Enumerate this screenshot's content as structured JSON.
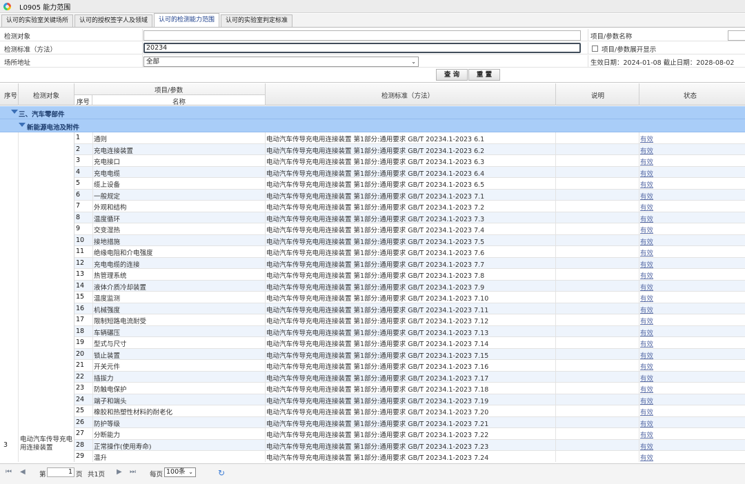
{
  "window": {
    "title": "L0905 能力范围"
  },
  "tabs": [
    {
      "label": "认可的实验室关键场所"
    },
    {
      "label": "认可的授权签字人及领域"
    },
    {
      "label": "认可的检测能力范围"
    },
    {
      "label": "认可的实验室判定标准"
    }
  ],
  "filters": {
    "object_label": "检测对象",
    "object_value": "",
    "standard_label": "检测标准（方法）",
    "standard_value": "20234",
    "site_label": "场所地址",
    "site_value": "全部",
    "param_label": "项目/参数名称",
    "param_value": "",
    "expand_label": "项目/参数展开显示",
    "date_text": "生效日期：2024-01-08 截止日期：2028-08-02",
    "query_button": "查 询",
    "reset_button": "重 置"
  },
  "grid": {
    "headers": {
      "seq": "序号",
      "object": "检测对象",
      "item_param": "项目/参数",
      "sub_seq": "序号",
      "sub_name": "名称",
      "standard": "检测标准（方法）",
      "note": "说明",
      "status": "状态"
    },
    "group1": "三、汽车零部件",
    "group2": "新能源电池及附件",
    "row_seq": "3",
    "row_object": "电动汽车传导充电用连接装置",
    "status_text": "有效",
    "rows": [
      {
        "n": "1",
        "name": "通则",
        "std": "电动汽车传导充电用连接装置 第1部分:通用要求 GB/T 20234.1-2023 6.1"
      },
      {
        "n": "2",
        "name": "充电连接装置",
        "std": "电动汽车传导充电用连接装置 第1部分:通用要求 GB/T 20234.1-2023 6.2"
      },
      {
        "n": "3",
        "name": "充电接口",
        "std": "电动汽车传导充电用连接装置 第1部分:通用要求 GB/T 20234.1-2023 6.3"
      },
      {
        "n": "4",
        "name": "充电电缆",
        "std": "电动汽车传导充电用连接装置 第1部分:通用要求 GB/T 20234.1-2023 6.4"
      },
      {
        "n": "5",
        "name": "缆上设备",
        "std": "电动汽车传导充电用连接装置 第1部分:通用要求 GB/T 20234.1-2023 6.5"
      },
      {
        "n": "6",
        "name": "一般规定",
        "std": "电动汽车传导充电用连接装置 第1部分:通用要求 GB/T 20234.1-2023 7.1"
      },
      {
        "n": "7",
        "name": "外观和结构",
        "std": "电动汽车传导充电用连接装置 第1部分:通用要求 GB/T 20234.1-2023 7.2"
      },
      {
        "n": "8",
        "name": "温度循环",
        "std": "电动汽车传导充电用连接装置 第1部分:通用要求 GB/T 20234.1-2023 7.3"
      },
      {
        "n": "9",
        "name": "交变湿热",
        "std": "电动汽车传导充电用连接装置 第1部分:通用要求 GB/T 20234.1-2023 7.4"
      },
      {
        "n": "10",
        "name": "接地措施",
        "std": "电动汽车传导充电用连接装置 第1部分:通用要求 GB/T 20234.1-2023 7.5"
      },
      {
        "n": "11",
        "name": "绝缘电阻和介电强度",
        "std": "电动汽车传导充电用连接装置 第1部分:通用要求 GB/T 20234.1-2023 7.6"
      },
      {
        "n": "12",
        "name": "充电电缆的连接",
        "std": "电动汽车传导充电用连接装置 第1部分:通用要求 GB/T 20234.1-2023 7.7"
      },
      {
        "n": "13",
        "name": "热管理系统",
        "std": "电动汽车传导充电用连接装置 第1部分:通用要求 GB/T 20234.1-2023 7.8"
      },
      {
        "n": "14",
        "name": "液体介质冷却装置",
        "std": "电动汽车传导充电用连接装置 第1部分:通用要求 GB/T 20234.1-2023 7.9"
      },
      {
        "n": "15",
        "name": "温度监测",
        "std": "电动汽车传导充电用连接装置 第1部分:通用要求 GB/T 20234.1-2023 7.10"
      },
      {
        "n": "16",
        "name": "机械强度",
        "std": "电动汽车传导充电用连接装置 第1部分:通用要求 GB/T 20234.1-2023 7.11"
      },
      {
        "n": "17",
        "name": "限制短路电流耐受",
        "std": "电动汽车传导充电用连接装置 第1部分:通用要求 GB/T 20234.1-2023 7.12"
      },
      {
        "n": "18",
        "name": "车辆碾压",
        "std": "电动汽车传导充电用连接装置 第1部分:通用要求 GB/T 20234.1-2023 7.13"
      },
      {
        "n": "19",
        "name": "型式与尺寸",
        "std": "电动汽车传导充电用连接装置 第1部分:通用要求 GB/T 20234.1-2023 7.14"
      },
      {
        "n": "20",
        "name": "锁止装置",
        "std": "电动汽车传导充电用连接装置 第1部分:通用要求 GB/T 20234.1-2023 7.15"
      },
      {
        "n": "21",
        "name": "开关元件",
        "std": "电动汽车传导充电用连接装置 第1部分:通用要求 GB/T 20234.1-2023 7.16"
      },
      {
        "n": "22",
        "name": "插拔力",
        "std": "电动汽车传导充电用连接装置 第1部分:通用要求 GB/T 20234.1-2023 7.17"
      },
      {
        "n": "23",
        "name": "防触电保护",
        "std": "电动汽车传导充电用连接装置 第1部分:通用要求 GB/T 20234.1-2023 7.18"
      },
      {
        "n": "24",
        "name": "端子和端头",
        "std": "电动汽车传导充电用连接装置 第1部分:通用要求 GB/T 20234.1-2023 7.19"
      },
      {
        "n": "25",
        "name": "橡胶和热塑性材料的耐老化",
        "std": "电动汽车传导充电用连接装置 第1部分:通用要求 GB/T 20234.1-2023 7.20"
      },
      {
        "n": "26",
        "name": "防护等级",
        "std": "电动汽车传导充电用连接装置 第1部分:通用要求 GB/T 20234.1-2023 7.21"
      },
      {
        "n": "27",
        "name": "分断能力",
        "std": "电动汽车传导充电用连接装置 第1部分:通用要求 GB/T 20234.1-2023 7.22"
      },
      {
        "n": "28",
        "name": "正常操作(使用寿命)",
        "std": "电动汽车传导充电用连接装置 第1部分:通用要求 GB/T 20234.1-2023 7.23"
      },
      {
        "n": "29",
        "name": "温升",
        "std": "电动汽车传导充电用连接装置 第1部分:通用要求 GB/T 20234.1-2023 7.24"
      }
    ]
  },
  "pager": {
    "page_prefix": "第",
    "page_value": "1",
    "page_suffix": "页",
    "total_text": "共1页",
    "per_page_label": "每页",
    "per_page_value": "100条"
  },
  "icons": {
    "first": "first-page-icon",
    "prev": "prev-page-icon",
    "next": "next-page-icon",
    "last": "last-page-icon",
    "refresh": "refresh-icon",
    "app": "app-logo-icon"
  }
}
